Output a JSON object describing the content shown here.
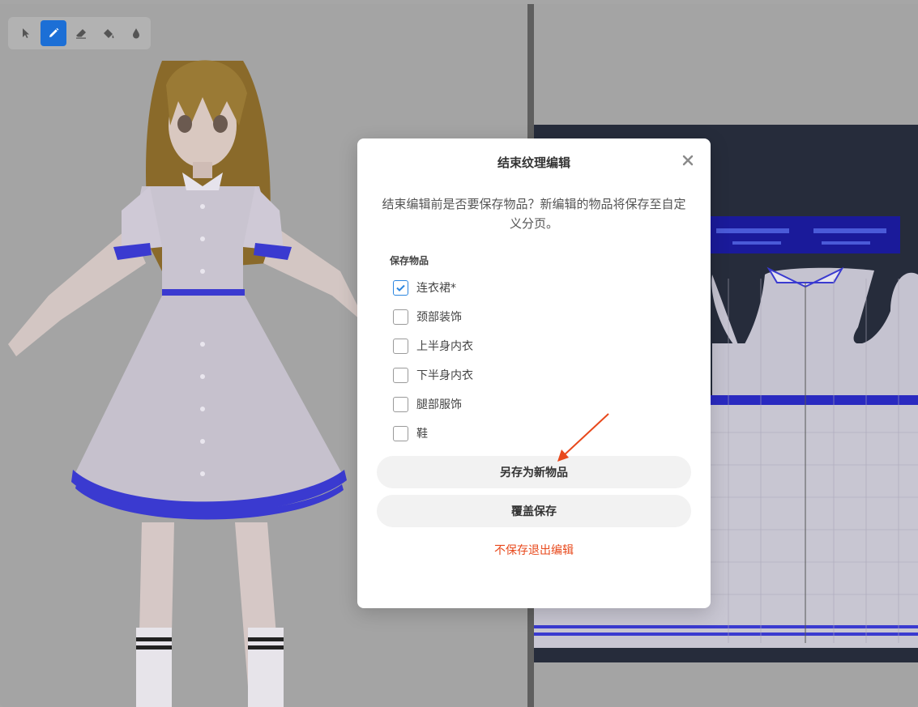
{
  "toolbar": {
    "tools": [
      {
        "icon": "cursor-icon",
        "active": false
      },
      {
        "icon": "pencil-icon",
        "active": true
      },
      {
        "icon": "eraser-icon",
        "active": false
      },
      {
        "icon": "fill-icon",
        "active": false
      },
      {
        "icon": "dropper-icon",
        "active": false
      }
    ]
  },
  "dialog": {
    "title": "结束纹理编辑",
    "description": "结束编辑前是否要保存物品？新编辑的物品将保存至自定义分页。",
    "section_label": "保存物品",
    "items": [
      {
        "label": "连衣裙*",
        "checked": true
      },
      {
        "label": "颈部装饰",
        "checked": false
      },
      {
        "label": "上半身内衣",
        "checked": false
      },
      {
        "label": "下半身内衣",
        "checked": false
      },
      {
        "label": "腿部服饰",
        "checked": false
      },
      {
        "label": "鞋",
        "checked": false
      }
    ],
    "save_new_label": "另存为新物品",
    "overwrite_label": "覆盖保存",
    "discard_label": "不保存退出编辑"
  },
  "colors": {
    "accent": "#1c6fd6",
    "danger": "#e8491c",
    "uv_background": "#262c3b",
    "dress_trim": "#3a3ad0"
  }
}
